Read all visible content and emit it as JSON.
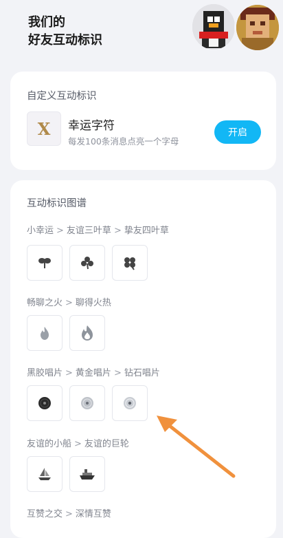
{
  "header": {
    "title_line1": "我们的",
    "title_line2": "好友互动标识"
  },
  "custom": {
    "title": "自定义互动标识",
    "icon_letter": "X",
    "name": "幸运字符",
    "desc": "每发100条消息点亮一个字母",
    "button": "开启"
  },
  "atlas": {
    "title": "互动标识图谱",
    "groups": [
      {
        "names": [
          "小幸运",
          "友谊三叶草",
          "挚友四叶草"
        ],
        "icons": [
          "two-leaf-clover-icon",
          "three-leaf-clover-icon",
          "four-leaf-clover-icon"
        ]
      },
      {
        "names": [
          "畅聊之火",
          "聊得火热"
        ],
        "icons": [
          "small-flame-icon",
          "big-flame-icon"
        ]
      },
      {
        "names": [
          "黑胶唱片",
          "黄金唱片",
          "钻石唱片"
        ],
        "icons": [
          "vinyl-record-icon",
          "gold-record-icon",
          "diamond-record-icon"
        ]
      },
      {
        "names": [
          "友谊的小船",
          "友谊的巨轮"
        ],
        "icons": [
          "sailboat-icon",
          "ship-icon"
        ]
      },
      {
        "names": [
          "互赞之交",
          "深情互赞"
        ],
        "icons": []
      }
    ],
    "separator": ">"
  },
  "colors": {
    "accent": "#12b7f5",
    "arrow": "#f0913d",
    "background": "#f2f3f7"
  }
}
